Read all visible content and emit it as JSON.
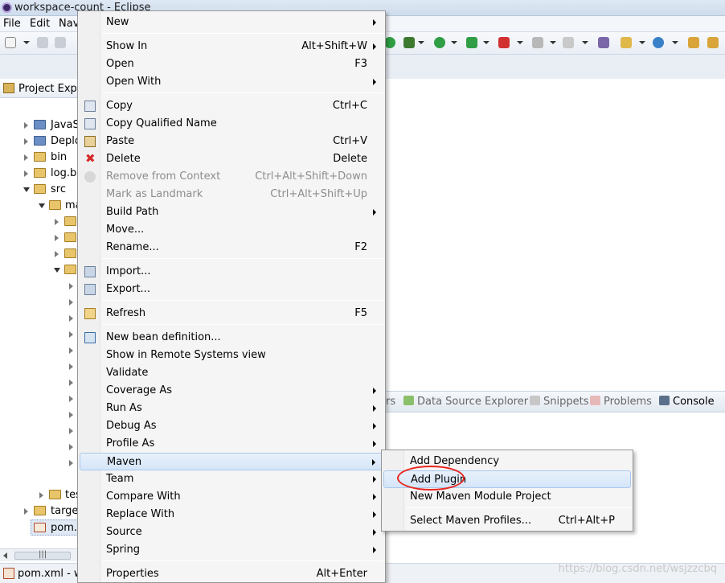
{
  "window": {
    "title": "workspace-count - Eclipse"
  },
  "menubar": {
    "items": [
      "File",
      "Edit",
      "Nav"
    ]
  },
  "explorer": {
    "title": "Project Explo",
    "tree": [
      {
        "label": "JavaS",
        "level": 1
      },
      {
        "label": "Deplo",
        "level": 1
      },
      {
        "label": "bin",
        "level": 1
      },
      {
        "label": "log.ba",
        "level": 1
      },
      {
        "label": "src",
        "level": 1
      },
      {
        "label": "ma",
        "level": 2
      },
      {
        "label": "tes",
        "level": 2
      },
      {
        "label": "target",
        "level": 1
      },
      {
        "label": "pom.x",
        "level": 1
      }
    ]
  },
  "bottom_tabs": {
    "partial": "rs",
    "data_source": "Data Source Explorer",
    "snippets": "Snippets",
    "problems": "Problems",
    "console": "Console"
  },
  "statusbar": {
    "file": "pom.xml - wa",
    "watermark": "https://blog.csdn.net/wsjzzcbq"
  },
  "context_menu": {
    "items": [
      {
        "label": "New",
        "shortcut": "",
        "submenu": true
      },
      {
        "label": "Show In",
        "shortcut": "Alt+Shift+W",
        "submenu": true
      },
      {
        "label": "Open",
        "shortcut": "F3"
      },
      {
        "label": "Open With",
        "shortcut": "",
        "submenu": true
      },
      {
        "label": "Copy",
        "shortcut": "Ctrl+C",
        "icon": "copy-icon"
      },
      {
        "label": "Copy Qualified Name",
        "shortcut": "",
        "icon": "copy-qualified-icon"
      },
      {
        "label": "Paste",
        "shortcut": "Ctrl+V",
        "icon": "paste-icon"
      },
      {
        "label": "Delete",
        "shortcut": "Delete",
        "icon": "delete-icon"
      },
      {
        "label": "Remove from Context",
        "shortcut": "Ctrl+Alt+Shift+Down",
        "disabled": true,
        "icon": "remove-context-icon"
      },
      {
        "label": "Mark as Landmark",
        "shortcut": "Ctrl+Alt+Shift+Up",
        "disabled": true
      },
      {
        "label": "Build Path",
        "shortcut": "",
        "submenu": true
      },
      {
        "label": "Move...",
        "shortcut": ""
      },
      {
        "label": "Rename...",
        "shortcut": "F2"
      },
      {
        "label": "Import...",
        "shortcut": "",
        "icon": "import-icon"
      },
      {
        "label": "Export...",
        "shortcut": "",
        "icon": "export-icon"
      },
      {
        "label": "Refresh",
        "shortcut": "F5",
        "icon": "refresh-icon"
      },
      {
        "label": "New bean definition...",
        "shortcut": "",
        "icon": "bean-icon"
      },
      {
        "label": "Show in Remote Systems view",
        "shortcut": ""
      },
      {
        "label": "Validate",
        "shortcut": ""
      },
      {
        "label": "Coverage As",
        "shortcut": "",
        "submenu": true
      },
      {
        "label": "Run As",
        "shortcut": "",
        "submenu": true
      },
      {
        "label": "Debug As",
        "shortcut": "",
        "submenu": true
      },
      {
        "label": "Profile As",
        "shortcut": "",
        "submenu": true
      },
      {
        "label": "Maven",
        "shortcut": "",
        "submenu": true,
        "active": true
      },
      {
        "label": "Team",
        "shortcut": "",
        "submenu": true
      },
      {
        "label": "Compare With",
        "shortcut": "",
        "submenu": true
      },
      {
        "label": "Replace With",
        "shortcut": "",
        "submenu": true
      },
      {
        "label": "Source",
        "shortcut": "",
        "submenu": true
      },
      {
        "label": "Spring",
        "shortcut": "",
        "submenu": true
      },
      {
        "label": "Properties",
        "shortcut": "Alt+Enter"
      }
    ]
  },
  "maven_submenu": {
    "items": [
      {
        "label": "Add Dependency",
        "shortcut": ""
      },
      {
        "label": "Add Plugin",
        "shortcut": "",
        "active": true
      },
      {
        "label": "New Maven Module Project",
        "shortcut": ""
      },
      {
        "label": "Select Maven Profiles...",
        "shortcut": "Ctrl+Alt+P"
      }
    ]
  },
  "colors": {
    "highlight": "#d5e5f8",
    "annotation_circle": "#e8261f"
  }
}
